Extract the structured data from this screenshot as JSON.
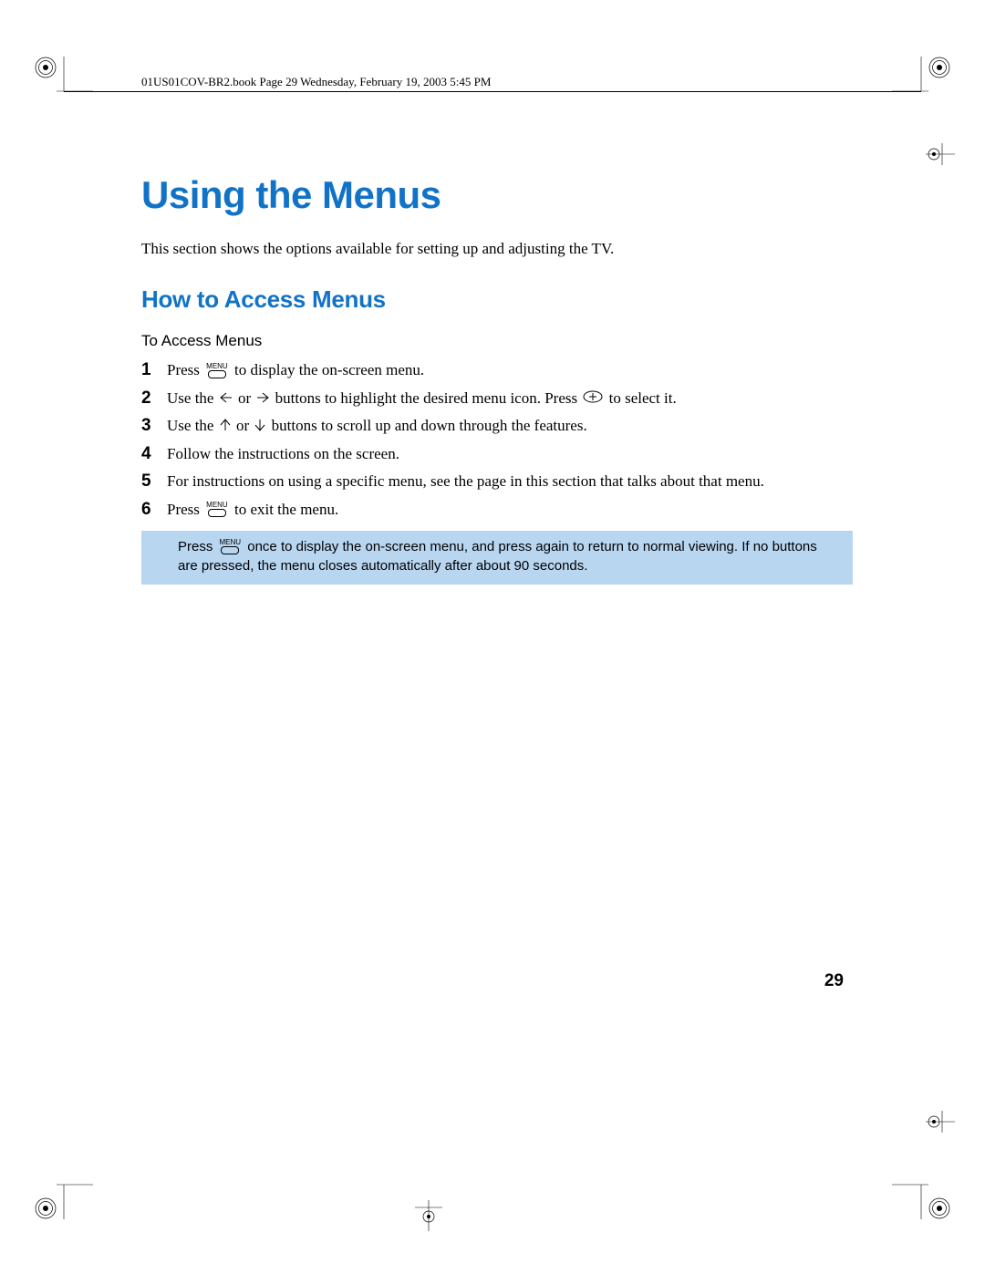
{
  "header": "01US01COV-BR2.book  Page 29  Wednesday, February 19, 2003  5:45 PM",
  "title": "Using the Menus",
  "intro": "This section shows the options available for setting up and adjusting the TV.",
  "subtitle": "How to Access Menus",
  "subhead": "To Access Menus",
  "steps": {
    "s1_a": "Press ",
    "s1_b": " to display the on-screen menu.",
    "s2_a": "Use the ",
    "s2_b": " or ",
    "s2_c": " buttons to highlight the desired menu icon. Press ",
    "s2_d": " to select it.",
    "s3_a": "Use the ",
    "s3_b": " or ",
    "s3_c": " buttons to scroll up and down through the features.",
    "s4": "Follow the instructions on the screen.",
    "s5": "For instructions on using a specific menu, see the page in this section that talks about that menu.",
    "s6_a": "Press ",
    "s6_b": " to exit the menu."
  },
  "nums": {
    "n1": "1",
    "n2": "2",
    "n3": "3",
    "n4": "4",
    "n5": "5",
    "n6": "6"
  },
  "menu_label": "MENU",
  "note_a": "Press ",
  "note_b": " once to display the on-screen menu, and press again to return to normal viewing. If no buttons are pressed, the menu closes automatically after about 90 seconds.",
  "page_number": "29"
}
